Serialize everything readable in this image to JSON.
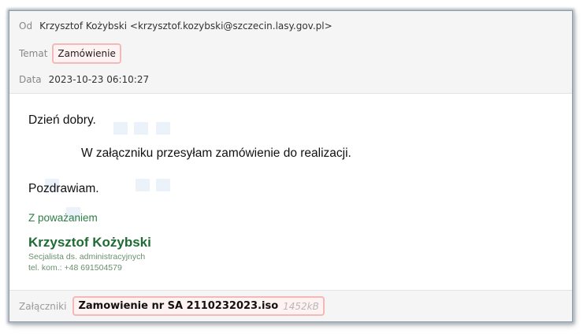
{
  "header": {
    "from_label": "Od",
    "from_value": "Krzysztof Kożybski <krzysztof.kozybski@szczecin.lasy.gov.pl>",
    "subject_label": "Temat",
    "subject_value": "Zamówienie",
    "date_label": "Data",
    "date_value": "2023-10-23 06:10:27"
  },
  "body": {
    "greeting": "Dzień dobry.",
    "line": "W załączniku przesyłam zamówienie do realizacji.",
    "closing": "Pozdrawiam.",
    "signature_intro": "Z poważaniem",
    "signature_name": "Krzysztof Kożybski",
    "signature_title": "Secjalista ds. administracyjnych",
    "signature_phone": "tel. kom.: +48 691504579"
  },
  "attachments": {
    "label": "Załączniki",
    "file_name": "Zamowienie nr SA 2110232023.iso",
    "file_size": "1452kB"
  },
  "colors": {
    "highlight_border": "#f3b8b8",
    "signature_green": "#1f6b34"
  }
}
